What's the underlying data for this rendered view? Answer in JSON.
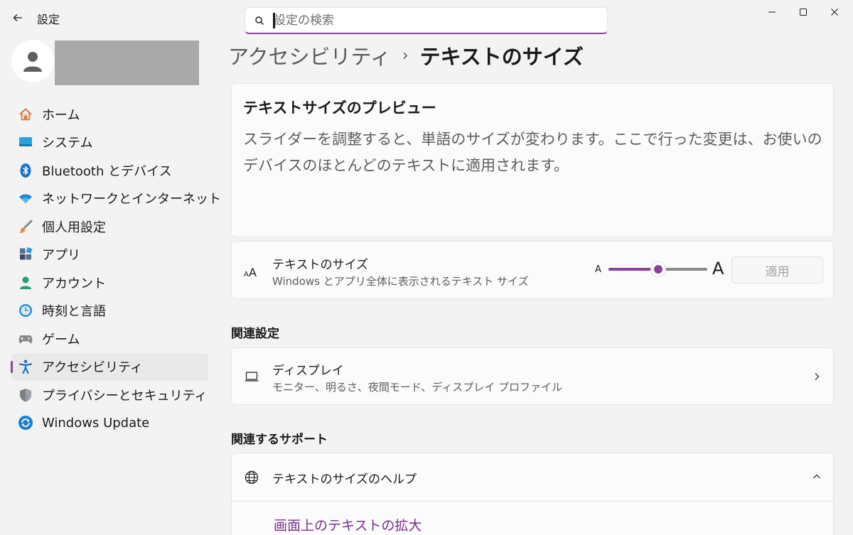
{
  "window": {
    "title": "設定"
  },
  "search": {
    "placeholder": "設定の検索"
  },
  "sidebar": {
    "items": [
      {
        "label": "ホーム",
        "icon": "home-icon"
      },
      {
        "label": "システム",
        "icon": "system-icon"
      },
      {
        "label": "Bluetooth とデバイス",
        "icon": "bluetooth-icon"
      },
      {
        "label": "ネットワークとインターネット",
        "icon": "wifi-icon"
      },
      {
        "label": "個人用設定",
        "icon": "brush-icon"
      },
      {
        "label": "アプリ",
        "icon": "apps-icon"
      },
      {
        "label": "アカウント",
        "icon": "account-icon"
      },
      {
        "label": "時刻と言語",
        "icon": "time-language-icon"
      },
      {
        "label": "ゲーム",
        "icon": "gamepad-icon"
      },
      {
        "label": "アクセシビリティ",
        "icon": "accessibility-icon",
        "active": true
      },
      {
        "label": "プライバシーとセキュリティ",
        "icon": "shield-icon"
      },
      {
        "label": "Windows Update",
        "icon": "windows-update-icon"
      }
    ]
  },
  "breadcrumb": {
    "parent": "アクセシビリティ",
    "separator": "›",
    "current": "テキストのサイズ"
  },
  "preview": {
    "title": "テキストサイズのプレビュー",
    "body": "スライダーを調整すると、単語のサイズが変わります。ここで行った変更は、お使いのデバイスのほとんどのテキストに適用されます。"
  },
  "text_size": {
    "title": "テキストのサイズ",
    "subtitle": "Windows とアプリ全体に表示されるテキスト サイズ",
    "small_label": "A",
    "large_label": "A",
    "slider_value": 0.5,
    "apply_label": "適用"
  },
  "related_settings": {
    "title": "関連設定",
    "display": {
      "title": "ディスプレイ",
      "subtitle": "モニター、明るさ、夜間モード、ディスプレイ プロファイル"
    }
  },
  "related_support": {
    "title": "関連するサポート",
    "help": {
      "title": "テキストのサイズのヘルプ",
      "link": "画面上のテキストの拡大"
    }
  },
  "colors": {
    "accent": "#8e3fa0",
    "background": "#f3f3f3",
    "card": "#fbfbfb"
  }
}
